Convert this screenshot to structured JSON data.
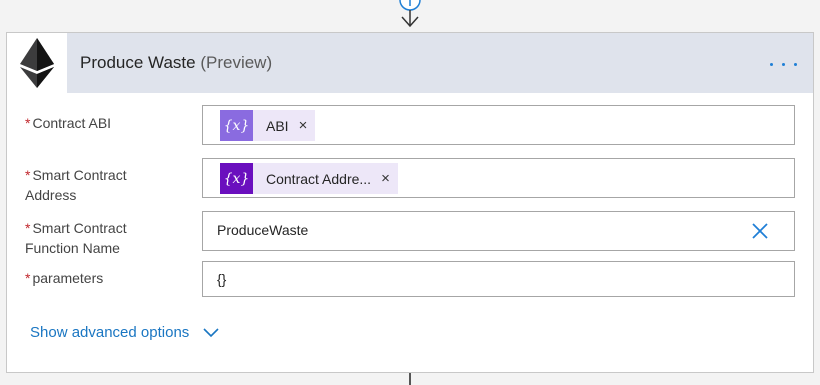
{
  "action": {
    "title": "Produce Waste",
    "preview_tag": "(Preview)",
    "more_label": "...",
    "logo_icon": "ethereum-icon"
  },
  "fields": [
    {
      "label_line1": "Contract ABI",
      "label_line2": "",
      "required_mark": "*",
      "token_text": "ABI",
      "token_icon": "{x}",
      "token_close": "×"
    },
    {
      "label_line1": "Smart Contract",
      "label_line2": "Address",
      "required_mark": "*",
      "token_text": "Contract Addre...",
      "token_icon": "{x}",
      "token_close": "×"
    },
    {
      "label_line1": "Smart Contract",
      "label_line2": "Function Name",
      "required_mark": "*",
      "value": "ProduceWaste"
    },
    {
      "label_line1": "parameters",
      "label_line2": "",
      "required_mark": "*",
      "value": "{}"
    }
  ],
  "advanced": {
    "label": "Show advanced options"
  },
  "colors": {
    "accent": "#1a76c2",
    "required": "#c1272d",
    "token_bg": "#ede7f8",
    "header_bg": "#dfe3ec"
  }
}
